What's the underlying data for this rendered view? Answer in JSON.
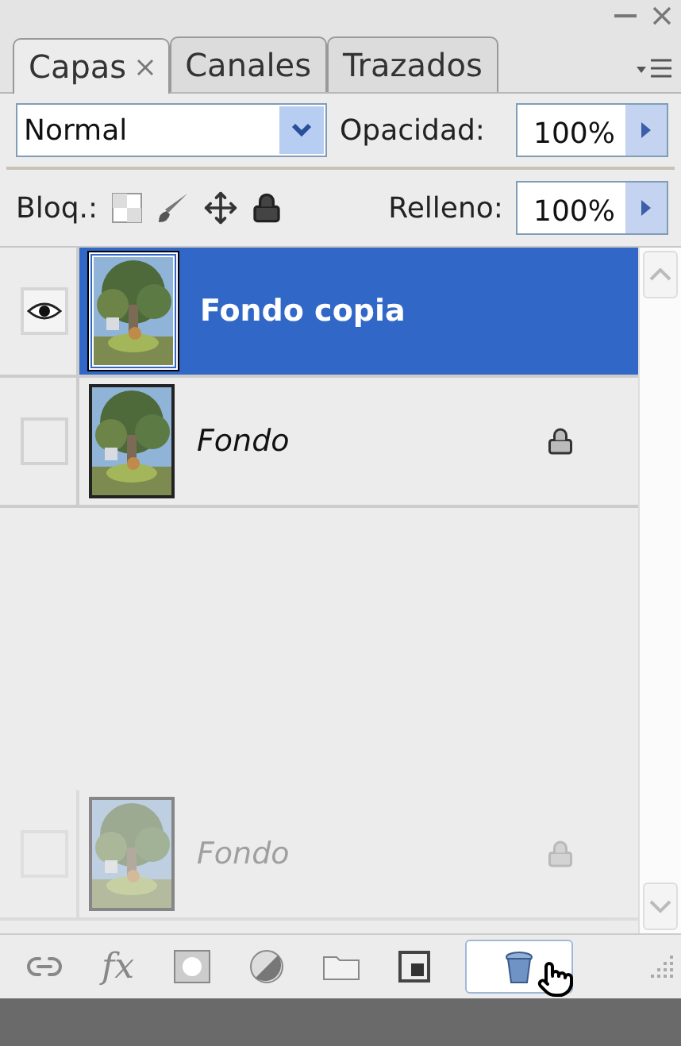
{
  "tabs": [
    {
      "label": "Capas",
      "selected": true,
      "closable": true
    },
    {
      "label": "Canales",
      "selected": false,
      "closable": false
    },
    {
      "label": "Trazados",
      "selected": false,
      "closable": false
    }
  ],
  "blend_mode": {
    "value": "Normal"
  },
  "opacity": {
    "label": "Opacidad:",
    "value": "100%"
  },
  "lock": {
    "label": "Bloq.:"
  },
  "fill": {
    "label": "Relleno:",
    "value": "100%"
  },
  "layers": [
    {
      "name": "Fondo copia",
      "visible": true,
      "selected": true,
      "locked": false
    },
    {
      "name": "Fondo",
      "visible": false,
      "selected": false,
      "locked": true
    }
  ],
  "drag_preview": {
    "name": "Fondo",
    "locked": true
  },
  "toolbar": [
    {
      "kind": "link",
      "hovered": false
    },
    {
      "kind": "fx",
      "label": "fx",
      "hovered": false
    },
    {
      "kind": "mask",
      "hovered": false
    },
    {
      "kind": "adjust",
      "hovered": false
    },
    {
      "kind": "folder",
      "hovered": false
    },
    {
      "kind": "new",
      "hovered": false
    },
    {
      "kind": "delete",
      "hovered": true
    }
  ]
}
